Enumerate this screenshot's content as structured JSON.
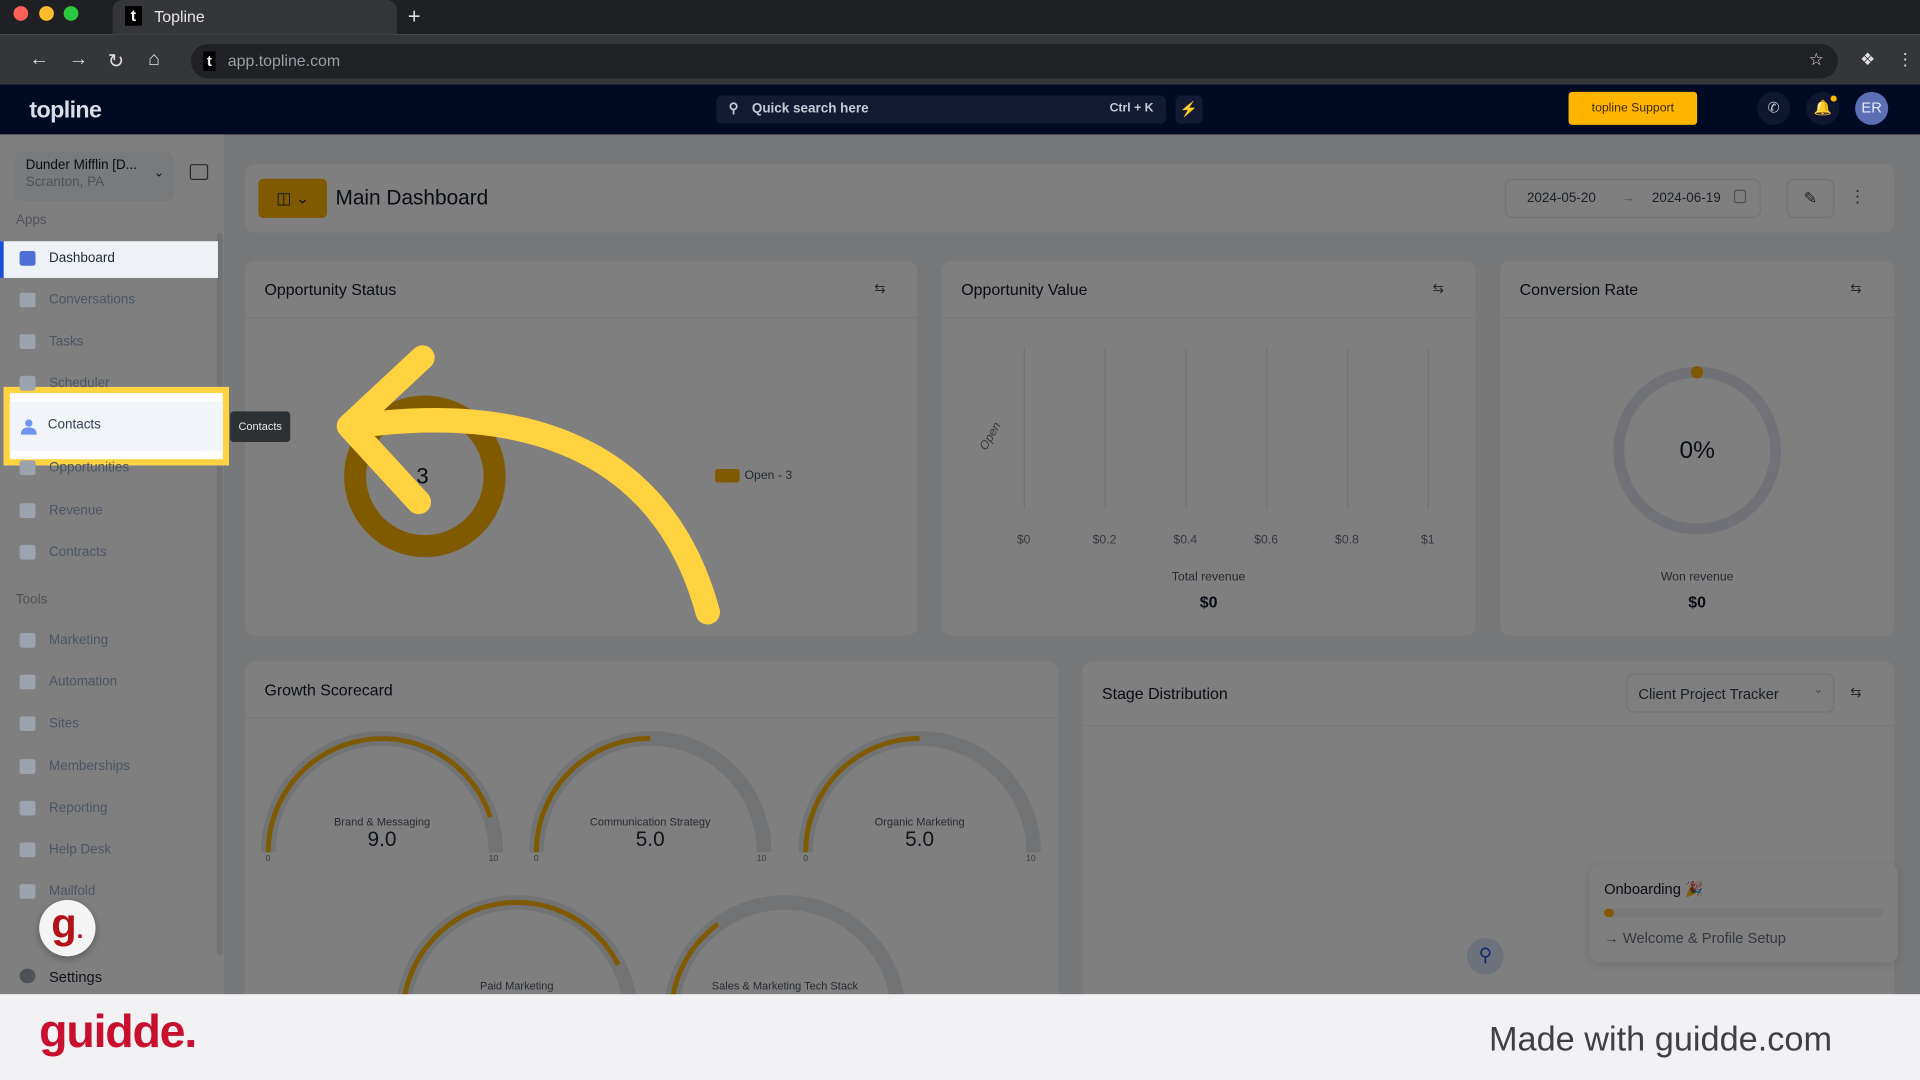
{
  "browser": {
    "tab_title": "Topline",
    "tab_favicon": "t",
    "url": "app.topline.com",
    "traffic_lights": [
      "#ff5f57",
      "#febc2e",
      "#28c840"
    ]
  },
  "header": {
    "logo": "topline",
    "search_placeholder": "Quick search here",
    "search_shortcut": "Ctrl + K",
    "support_label": "topline Support",
    "avatar_initials": "ER",
    "accent_color": "#ffb400"
  },
  "sidebar": {
    "account_name": "Dunder Mifflin [D...",
    "account_location": "Scranton, PA",
    "apps_heading": "Apps",
    "apps": [
      {
        "label": "Dashboard",
        "icon": "dashboard-icon",
        "active": true
      },
      {
        "label": "Conversations",
        "icon": "chat-icon"
      },
      {
        "label": "Tasks",
        "icon": "task-icon"
      },
      {
        "label": "Scheduler",
        "icon": "calendar-icon"
      },
      {
        "label": "Contacts",
        "icon": "person-icon"
      },
      {
        "label": "Opportunities",
        "icon": "target-icon"
      },
      {
        "label": "Revenue",
        "icon": "card-icon"
      },
      {
        "label": "Contracts",
        "icon": "document-icon"
      }
    ],
    "tools_heading": "Tools",
    "tools": [
      {
        "label": "Marketing",
        "icon": "megaphone-icon"
      },
      {
        "label": "Automation",
        "icon": "gears-icon"
      },
      {
        "label": "Sites",
        "icon": "globe-icon"
      },
      {
        "label": "Memberships",
        "icon": "members-icon"
      },
      {
        "label": "Reporting",
        "icon": "pie-icon"
      },
      {
        "label": "Help Desk",
        "icon": "help-icon"
      },
      {
        "label": "Mailfold",
        "icon": "mail-icon"
      }
    ],
    "settings_label": "Settings",
    "tooltip": "Contacts"
  },
  "dashboard": {
    "title": "Main Dashboard",
    "date_start": "2024-05-20",
    "date_end": "2024-06-19"
  },
  "widgets": {
    "opportunity_status": {
      "title": "Opportunity Status",
      "total": "3",
      "legend": "Open - 3"
    },
    "opportunity_value": {
      "title": "Opportunity Value",
      "category": "Open",
      "ticks": [
        "$0",
        "$0.2",
        "$0.4",
        "$0.6",
        "$0.8",
        "$1"
      ],
      "total_label": "Total revenue",
      "total_value": "$0"
    },
    "conversion_rate": {
      "title": "Conversion Rate",
      "value": "0%",
      "won_label": "Won revenue",
      "won_value": "$0"
    },
    "growth_scorecard": {
      "title": "Growth Scorecard",
      "min": "0",
      "max": "10",
      "gauges": [
        {
          "label": "Brand & Messaging",
          "value": "9.0",
          "level": 0.9
        },
        {
          "label": "Communication Strategy",
          "value": "5.0",
          "level": 0.5
        },
        {
          "label": "Organic Marketing",
          "value": "5.0",
          "level": 0.5
        },
        {
          "label": "Paid Marketing",
          "level": 0.85
        },
        {
          "label": "Sales & Marketing Tech Stack",
          "level": 0.3
        }
      ]
    },
    "stage_distribution": {
      "title": "Stage Distribution",
      "pipeline": "Client Project Tracker"
    }
  },
  "onboarding": {
    "title": "Onboarding",
    "progress": 0.02,
    "step": "Welcome & Profile Setup"
  },
  "footer": {
    "brand": "guidde.",
    "made_with": "Made with guidde.com"
  }
}
